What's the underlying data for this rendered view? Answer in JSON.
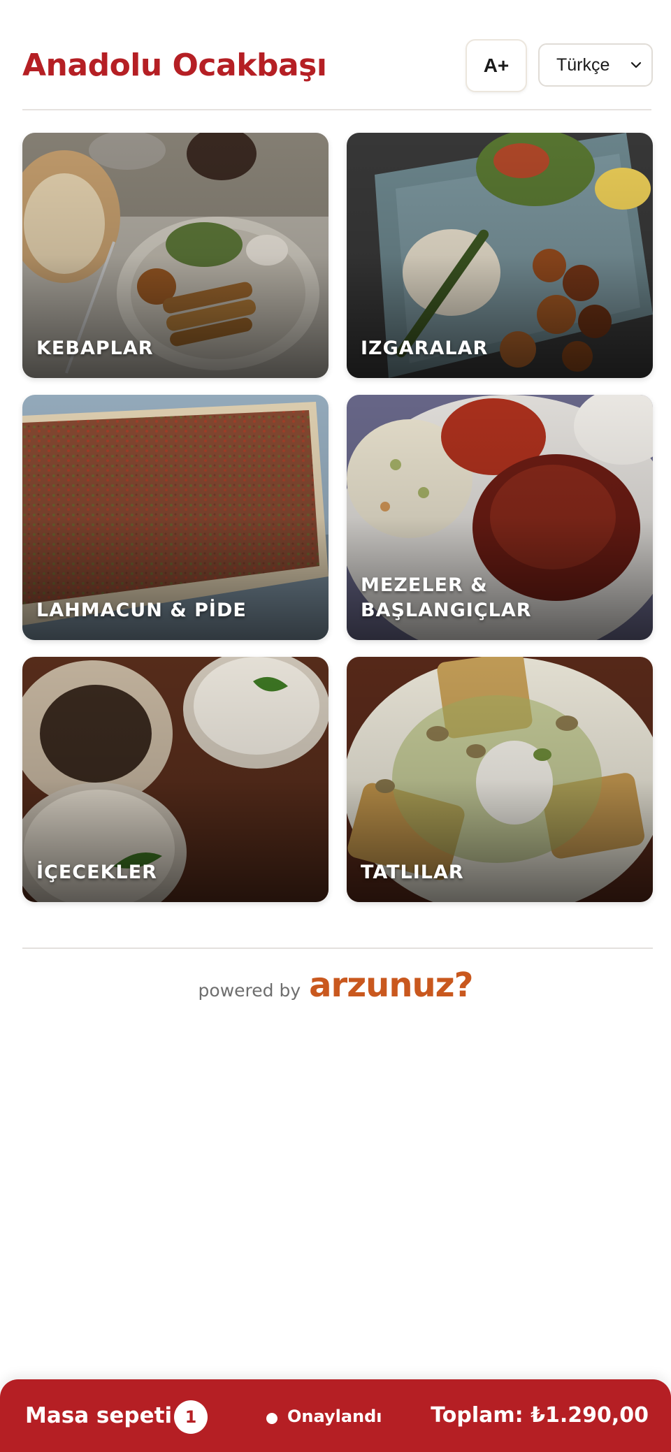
{
  "header": {
    "restaurant_name": "Anadolu Ocakbaşı",
    "font_size_button": "A+",
    "language": {
      "selected": "Türkçe",
      "icon": "chevron-down-icon"
    }
  },
  "categories": [
    {
      "id": "kebaplar",
      "label": "KEBAPLAR"
    },
    {
      "id": "izgaralar",
      "label": "IZGARALAR"
    },
    {
      "id": "lahmacun-pide",
      "label": "LAHMACUN & PİDE"
    },
    {
      "id": "mezeler",
      "label": "MEZELER &\nBAŞLANGIÇLAR"
    },
    {
      "id": "icecekler",
      "label": "İÇECEKLER"
    },
    {
      "id": "tatlilar",
      "label": "TATLILAR"
    }
  ],
  "footer": {
    "powered_by": "powered by",
    "brand": "arzunuz?"
  },
  "basket": {
    "label": "Masa sepeti",
    "count": "1",
    "status": "Onaylandı",
    "total": "Toplam: ₺1.290,00"
  },
  "colors": {
    "brand_red": "#b51f24",
    "arzunuz_orange": "#c9581e"
  }
}
